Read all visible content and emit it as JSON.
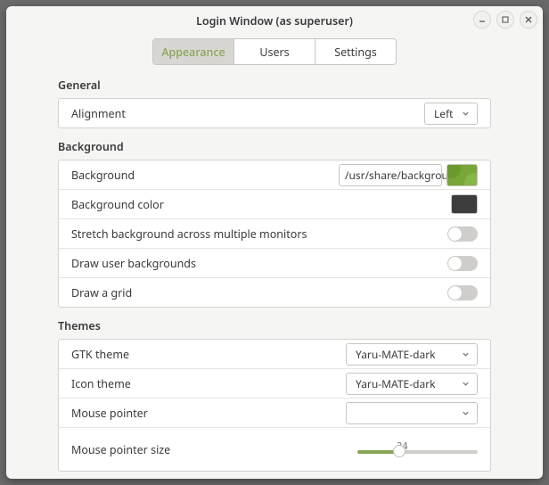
{
  "window": {
    "title": "Login Window (as superuser)"
  },
  "tabs": {
    "appearance": "Appearance",
    "users": "Users",
    "settings": "Settings"
  },
  "sections": {
    "general": {
      "title": "General",
      "alignment_label": "Alignment",
      "alignment_value": "Left"
    },
    "background": {
      "title": "Background",
      "bg_label": "Background",
      "bg_path": "/usr/share/background",
      "bg_color_label": "Background color",
      "stretch_label": "Stretch background across multiple monitors",
      "user_bg_label": "Draw user backgrounds",
      "grid_label": "Draw a grid"
    },
    "themes": {
      "title": "Themes",
      "gtk_label": "GTK theme",
      "gtk_value": "Yaru-MATE-dark",
      "icon_label": "Icon theme",
      "icon_value": "Yaru-MATE-dark",
      "pointer_label": "Mouse pointer",
      "pointer_value": "",
      "pointer_size_label": "Mouse pointer size",
      "pointer_size_value": "24"
    }
  },
  "colors": {
    "bg_color_swatch": "#3c3c3c",
    "bg_preview": "#78a638"
  }
}
